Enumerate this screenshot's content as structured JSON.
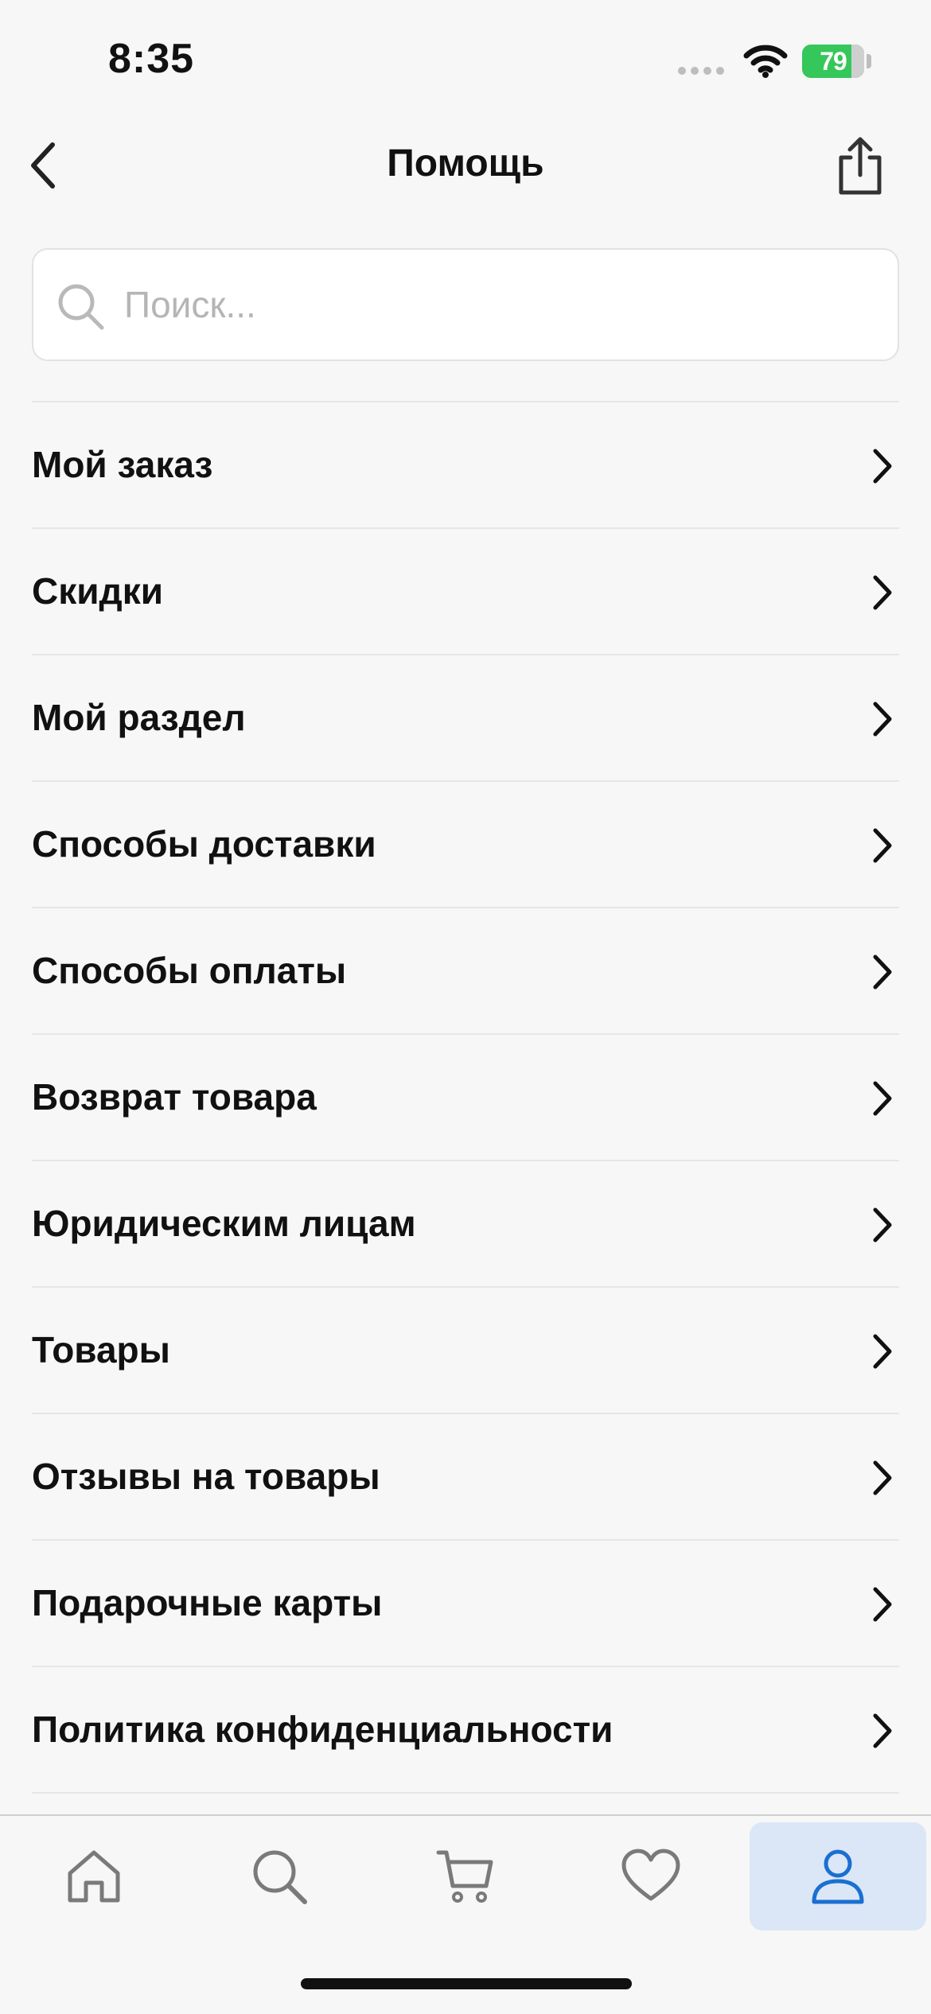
{
  "status_bar": {
    "time": "8:35",
    "battery_level": "79",
    "battery_color": "#35c759"
  },
  "nav": {
    "title": "Помощь",
    "back_icon": "chevron-left-icon",
    "share_icon": "share-icon"
  },
  "search": {
    "placeholder": "Поиск...",
    "value": ""
  },
  "menu": {
    "items": [
      {
        "label": "Мой заказ"
      },
      {
        "label": "Скидки"
      },
      {
        "label": "Мой раздел"
      },
      {
        "label": "Способы доставки"
      },
      {
        "label": "Способы оплаты"
      },
      {
        "label": "Возврат товара"
      },
      {
        "label": "Юридическим лицам"
      },
      {
        "label": "Товары"
      },
      {
        "label": "Отзывы на товары"
      },
      {
        "label": "Подарочные карты"
      },
      {
        "label": "Политика конфиденциальности"
      }
    ]
  },
  "tab_bar": {
    "tabs": [
      {
        "icon": "home-icon",
        "active": false
      },
      {
        "icon": "search-icon",
        "active": false
      },
      {
        "icon": "cart-icon",
        "active": false
      },
      {
        "icon": "heart-icon",
        "active": false
      },
      {
        "icon": "profile-icon",
        "active": true
      }
    ],
    "active_color": "#1a6fd1",
    "inactive_color": "#7a7a7a",
    "active_background": "#dbe7f6"
  }
}
